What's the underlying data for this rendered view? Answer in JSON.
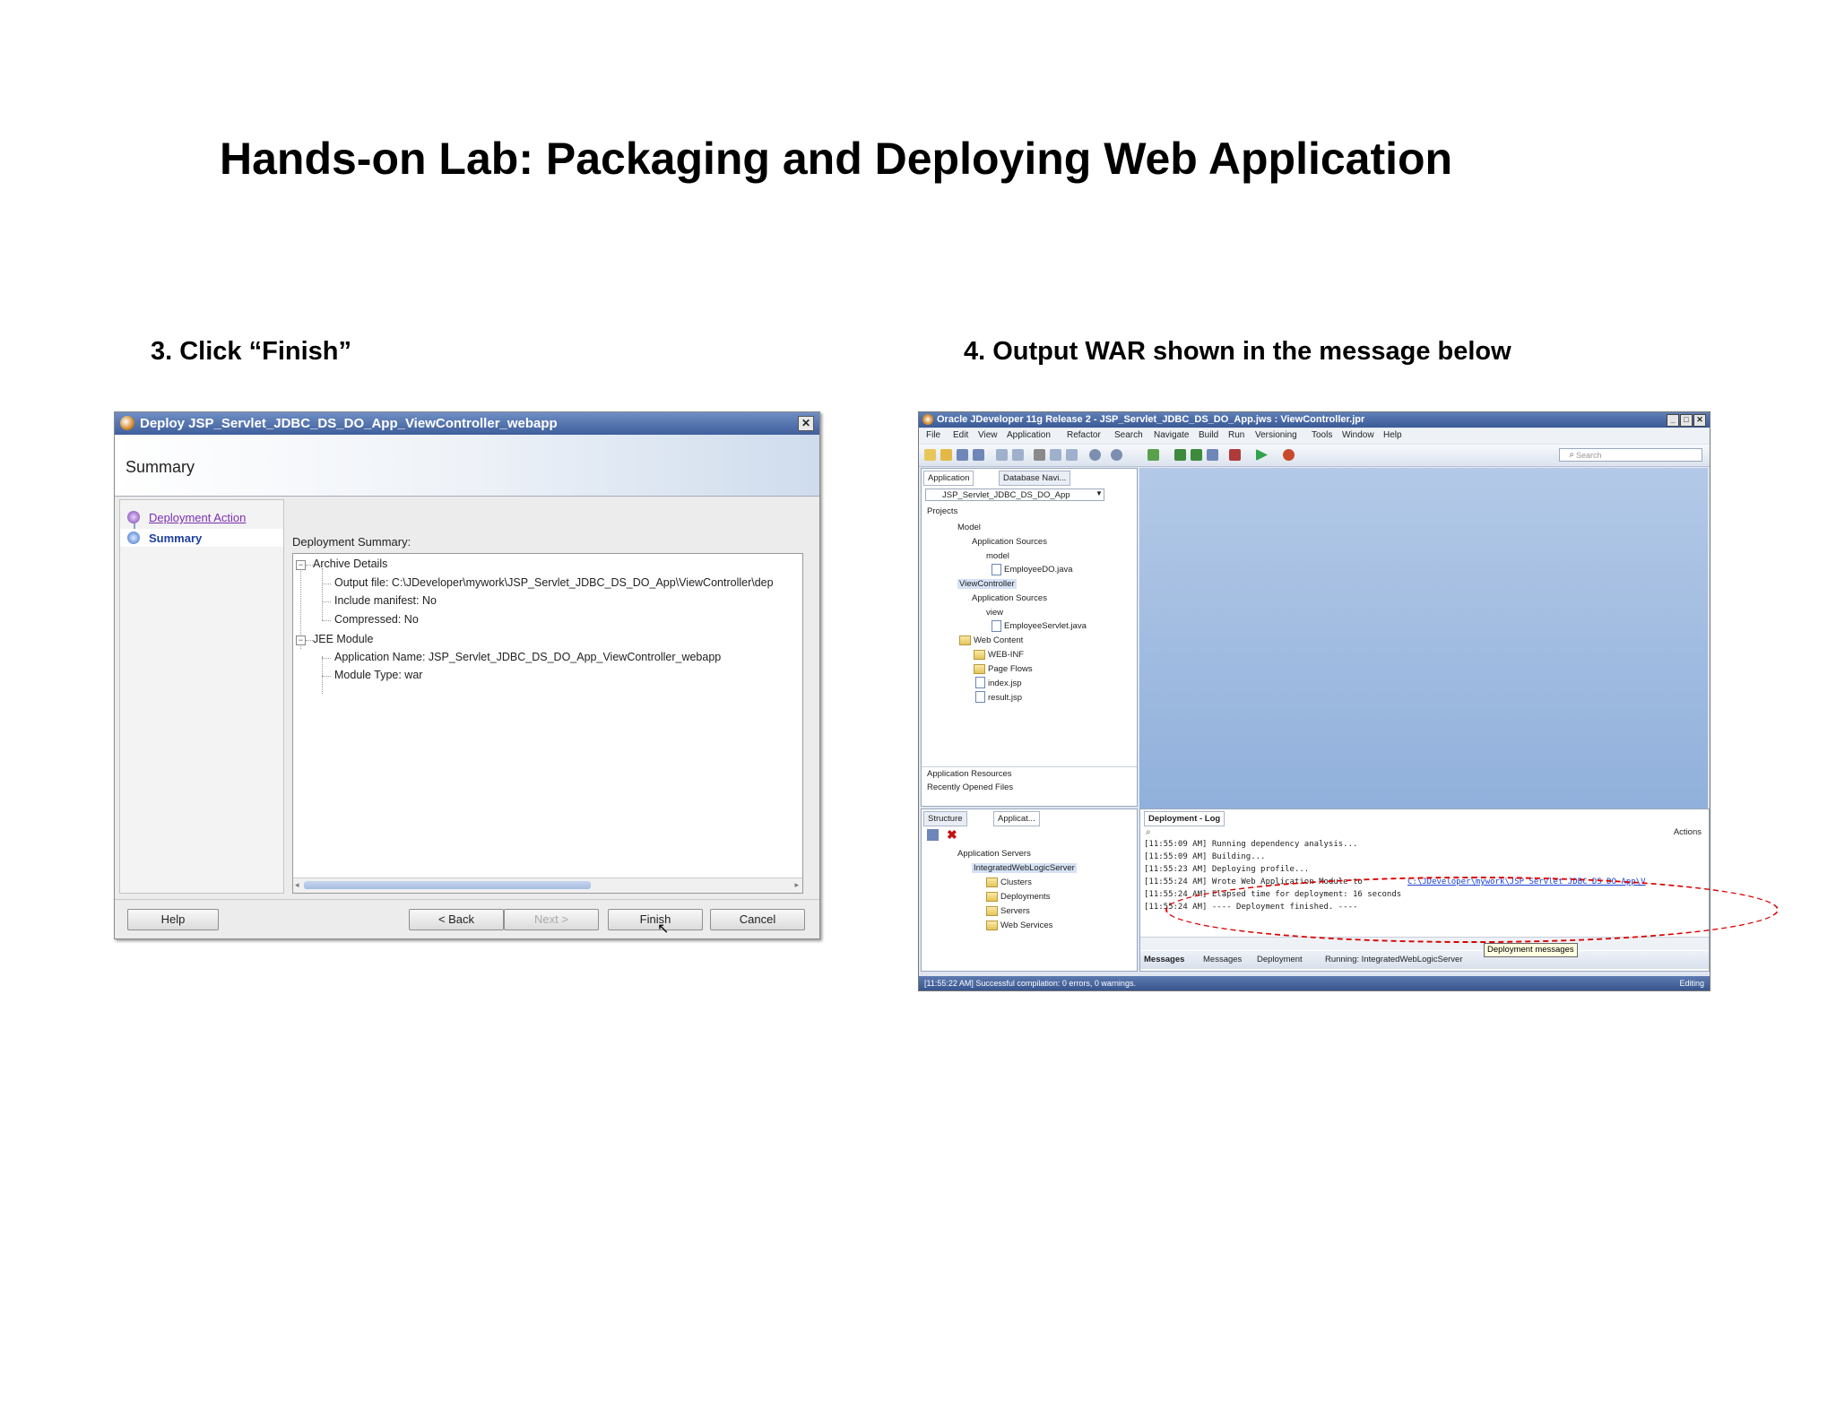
{
  "slide": {
    "title": "Hands-on Lab: Packaging and Deploying Web Application",
    "step3": "3. Click “Finish”",
    "step4": "4. Output WAR shown in the message below"
  },
  "dialog": {
    "title": "Deploy JSP_Servlet_JDBC_DS_DO_App_ViewController_webapp",
    "header": "Summary",
    "nav": [
      "Deployment Action",
      "Summary"
    ],
    "summary_label": "Deployment Summary:",
    "tree": {
      "archive": "Archive Details",
      "output_file": "Output file: C:\\JDeveloper\\mywork\\JSP_Servlet_JDBC_DS_DO_App\\ViewController\\dep",
      "include_manifest": "Include manifest: No",
      "compressed": "Compressed: No",
      "jee_module": "JEE Module",
      "app_name": "Application Name: JSP_Servlet_JDBC_DS_DO_App_ViewController_webapp",
      "module_type": "Module Type: war"
    },
    "buttons": {
      "help": "Help",
      "back": "< Back",
      "next": "Next >",
      "finish": "Finish",
      "cancel": "Cancel"
    }
  },
  "ide": {
    "title": "Oracle JDeveloper 11g Release 2 - JSP_Servlet_JDBC_DS_DO_App.jws : ViewController.jpr",
    "menu": [
      "File",
      "Edit",
      "View",
      "Application",
      "Refactor",
      "Search",
      "Navigate",
      "Build",
      "Run",
      "Versioning",
      "Tools",
      "Window",
      "Help"
    ],
    "search_placeholder": "Search",
    "app_nav_tabs": [
      "Application",
      "Database Navi..."
    ],
    "app_selector": "JSP_Servlet_JDBC_DS_DO_App",
    "projects_label": "Projects",
    "tree": {
      "model": "Model",
      "model_sources": "Application Sources",
      "model_pkg": "model",
      "employee_do": "EmployeeDO.java",
      "viewcontroller": "ViewController",
      "vc_sources": "Application Sources",
      "vc_pkg": "view",
      "employee_servlet": "EmployeeServlet.java",
      "web_content": "Web Content",
      "web_inf": "WEB-INF",
      "page_flows": "Page Flows",
      "index": "index.jsp",
      "result": "result.jsp"
    },
    "app_resources": "Application Resources",
    "recent_files": "Recently Opened Files",
    "bottom_tabs": [
      "Structure",
      "Applicat..."
    ],
    "servers": {
      "root": "Application Servers",
      "wls": "IntegratedWebLogicServer",
      "items": [
        "Clusters",
        "Deployments",
        "Servers",
        "Web Services"
      ]
    },
    "log_tab": "Deployment - Log",
    "actions": "Actions",
    "log_lines": [
      "[11:55:09 AM] Running dependency analysis...",
      "[11:55:09 AM] Building...",
      "[11:55:23 AM] Deploying profile...",
      "[11:55:24 AM] Wrote Web Application Module to",
      "[11:55:24 AM] Elapsed time for deployment:  16 seconds",
      "[11:55:24 AM] ----  Deployment finished.  ----"
    ],
    "log_link": "C:\\JDeveloper\\mywork\\JSP_Servlet_JDBC_DS_DO_App\\V",
    "tooltip": "Deployment messages",
    "message_tabs": [
      "Messages",
      "Messages",
      "Deployment",
      "Running: IntegratedWebLogicServer"
    ],
    "status": "[11:55:22 AM] Successful compilation: 0 errors, 0 warnings.",
    "status_right": "Editing"
  },
  "colors": {
    "titlebar": "#3f5f9c",
    "annotation": "#dd0000",
    "link": "#1a3fd6"
  }
}
